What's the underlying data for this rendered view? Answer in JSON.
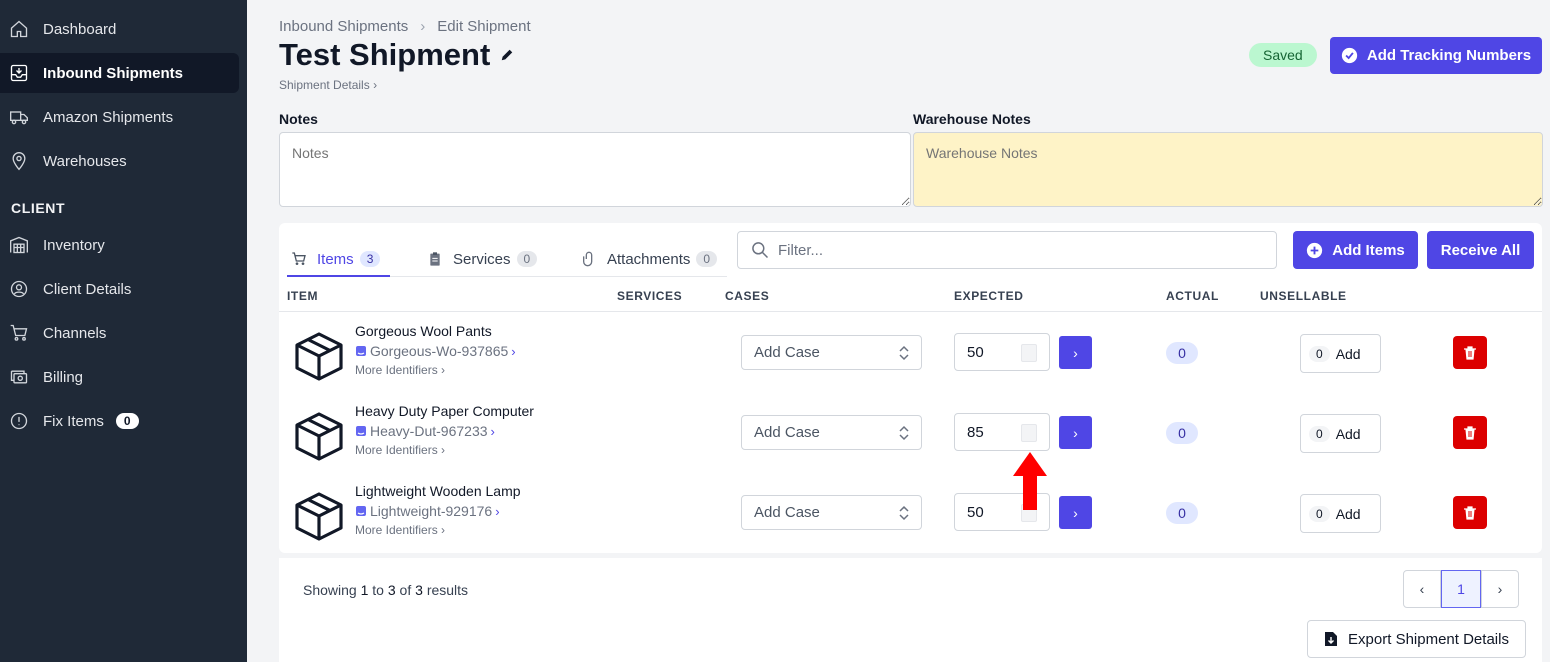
{
  "sidebar": {
    "items": [
      {
        "label": "Dashboard",
        "icon": "home-icon"
      },
      {
        "label": "Inbound Shipments",
        "icon": "inbox-icon",
        "active": true
      },
      {
        "label": "Amazon Shipments",
        "icon": "truck-icon"
      },
      {
        "label": "Warehouses",
        "icon": "map-pin-icon"
      }
    ],
    "section_label": "CLIENT",
    "client_items": [
      {
        "label": "Inventory",
        "icon": "warehouse-icon"
      },
      {
        "label": "Client Details",
        "icon": "user-circle-icon"
      },
      {
        "label": "Channels",
        "icon": "cart-icon"
      },
      {
        "label": "Billing",
        "icon": "billing-icon"
      },
      {
        "label": "Fix Items",
        "icon": "alert-circle-icon",
        "badge": "0"
      }
    ]
  },
  "header": {
    "breadcrumb": [
      "Inbound Shipments",
      "Edit Shipment"
    ],
    "title": "Test Shipment",
    "subcrumb": "Shipment Details",
    "saved_label": "Saved",
    "tracking_button": "Add Tracking Numbers"
  },
  "notes": {
    "label": "Notes",
    "placeholder": "Notes",
    "warehouse_label": "Warehouse Notes",
    "warehouse_placeholder": "Warehouse Notes"
  },
  "tabs": [
    {
      "label": "Items",
      "count": "3",
      "icon": "cart-icon",
      "active": true
    },
    {
      "label": "Services",
      "count": "0",
      "icon": "clipboard-icon"
    },
    {
      "label": "Attachments",
      "count": "0",
      "icon": "paperclip-icon"
    }
  ],
  "filter": {
    "placeholder": "Filter..."
  },
  "actions": {
    "add_items": "Add Items",
    "receive_all": "Receive All"
  },
  "table": {
    "columns": [
      "ITEM",
      "SERVICES",
      "CASES",
      "EXPECTED",
      "ACTUAL",
      "UNSELLABLE"
    ],
    "rows": [
      {
        "name": "Gorgeous Wool Pants",
        "sku": "Gorgeous-Wo-937865",
        "more": "More Identifiers",
        "case": "Add Case",
        "expected": "50",
        "actual": "0",
        "unsellable": "0",
        "add": "Add"
      },
      {
        "name": "Heavy Duty Paper Computer",
        "sku": "Heavy-Dut-967233",
        "more": "More Identifiers",
        "case": "Add Case",
        "expected": "85",
        "actual": "0",
        "unsellable": "0",
        "add": "Add"
      },
      {
        "name": "Lightweight Wooden Lamp",
        "sku": "Lightweight-929176",
        "more": "More Identifiers",
        "case": "Add Case",
        "expected": "50",
        "actual": "0",
        "unsellable": "0",
        "add": "Add"
      }
    ]
  },
  "footer": {
    "showing": "Showing",
    "from": "1",
    "to_word": "to",
    "to": "3",
    "of_word": "of",
    "total": "3",
    "results_word": "results",
    "current_page": "1",
    "export_button": "Export Shipment Details"
  },
  "colors": {
    "accent": "#4f46e5",
    "danger": "#dc0000",
    "saved": "#bbf7d0",
    "warehouse_notes_bg": "#fef3c7",
    "sidebar": "#1f2937"
  }
}
